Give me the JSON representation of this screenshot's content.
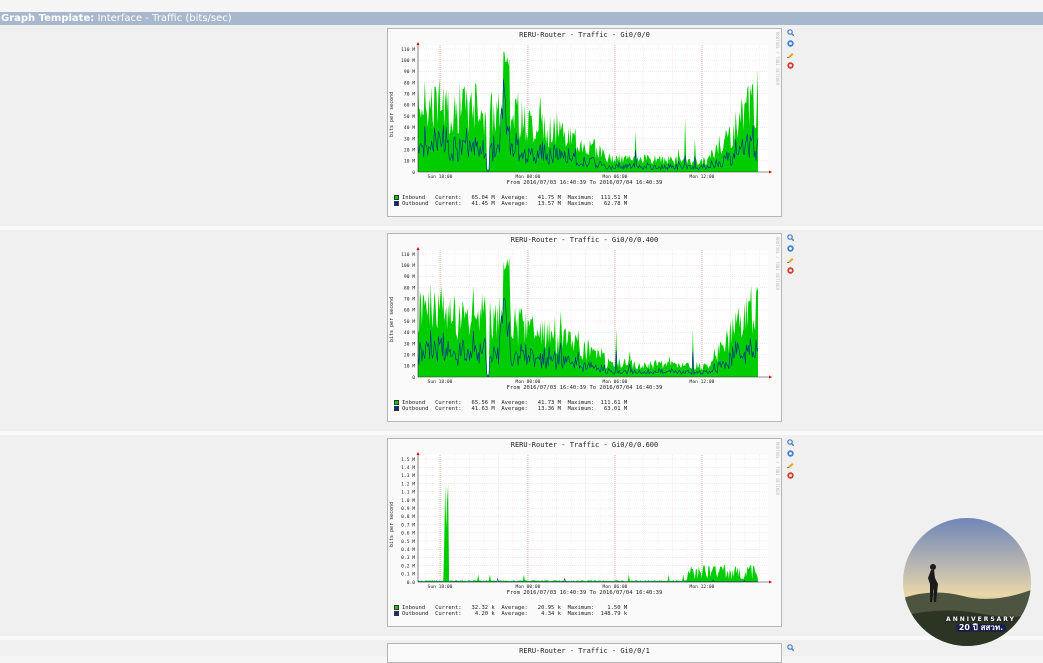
{
  "header": {
    "label": "Graph Template:",
    "value": "Interface - Traffic (bits/sec)"
  },
  "colors": {
    "inbound": "#00cc00",
    "outbound": "#002a97",
    "header": "#a8b8cc"
  },
  "common": {
    "ylabel": "bits per second",
    "rrdtool_label": "RRDTOOL / TOBI OETIKER",
    "period": "From 2016/07/03 16:40:39 To 2016/07/04 16:40:39",
    "xticks": [
      "Sun 18:00",
      "Mon 00:00",
      "Mon 06:00",
      "Mon 12:00"
    ],
    "legend_labels": [
      "Inbound",
      "Outbound"
    ],
    "icons": [
      "zoom-icon",
      "csv-export-icon",
      "edit-icon",
      "realtime-icon"
    ]
  },
  "graphs": [
    {
      "title": "RERU-Router - Traffic - Gi0/0/0",
      "yticks": [
        "110 M",
        "100 M",
        "90 M",
        "80 M",
        "70 M",
        "60 M",
        "50 M",
        "40 M",
        "30 M",
        "20 M",
        "10 M",
        "0"
      ],
      "legend": [
        "Inbound   Current:   65.04 M  Average:   41.75 M  Maximum:  111.51 M",
        "Outbound  Current:   41.45 M  Average:   13.57 M  Maximum:   62.78 M"
      ]
    },
    {
      "title": "RERU-Router - Traffic - Gi0/0/0.400",
      "yticks": [
        "110 M",
        "100 M",
        "90 M",
        "80 M",
        "70 M",
        "60 M",
        "50 M",
        "40 M",
        "30 M",
        "20 M",
        "10 M",
        "0"
      ],
      "legend": [
        "Inbound   Current:   65.56 M  Average:   41.73 M  Maximum:  111.61 M",
        "Outbound  Current:   41.63 M  Average:   13.36 M  Maximum:   63.01 M"
      ]
    },
    {
      "title": "RERU-Router - Traffic - Gi0/0/0.600",
      "yticks": [
        "1.5 M",
        "1.4 M",
        "1.3 M",
        "1.2 M",
        "1.1 M",
        "1.0 M",
        "0.9 M",
        "0.8 M",
        "0.7 M",
        "0.6 M",
        "0.5 M",
        "0.4 M",
        "0.3 M",
        "0.2 M",
        "0.1 M",
        "0.0"
      ],
      "legend": [
        "Inbound   Current:   32.32 k  Average:   20.95 k  Maximum:    1.50 M",
        "Outbound  Current:    4.20 k  Average:    4.34 k  Maximum:  148.79 k"
      ]
    },
    {
      "title": "RERU-Router - Traffic - Gi0/0/1"
    }
  ],
  "avatar_badge": {
    "line1": "ANNIVERSARY",
    "line2": "20 ปี สสวท."
  }
}
